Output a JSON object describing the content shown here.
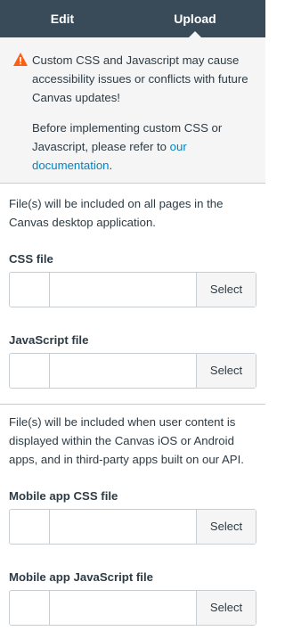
{
  "tabs": {
    "edit": "Edit",
    "upload": "Upload"
  },
  "warning": {
    "message": "Custom CSS and Javascript may cause accessibility issues or conflicts with future Canvas updates!",
    "refer_prefix": "Before implementing custom CSS or Javascript, please refer to ",
    "link_text": "our documentation",
    "refer_suffix": "."
  },
  "desktop": {
    "description": "File(s) will be included on all pages in the Canvas desktop application.",
    "css_label": "CSS file",
    "js_label": "JavaScript file",
    "select_label": "Select"
  },
  "mobile": {
    "description": "File(s) will be included when user content is displayed within the Canvas iOS or Android apps, and in third-party apps built on our API.",
    "css_label": "Mobile app CSS file",
    "js_label": "Mobile app JavaScript file",
    "select_label": "Select"
  },
  "colors": {
    "header_bg": "#394b58",
    "warning_bg": "#f5f5f5",
    "link": "#0084c3",
    "warning_icon": "#fc5e13"
  }
}
